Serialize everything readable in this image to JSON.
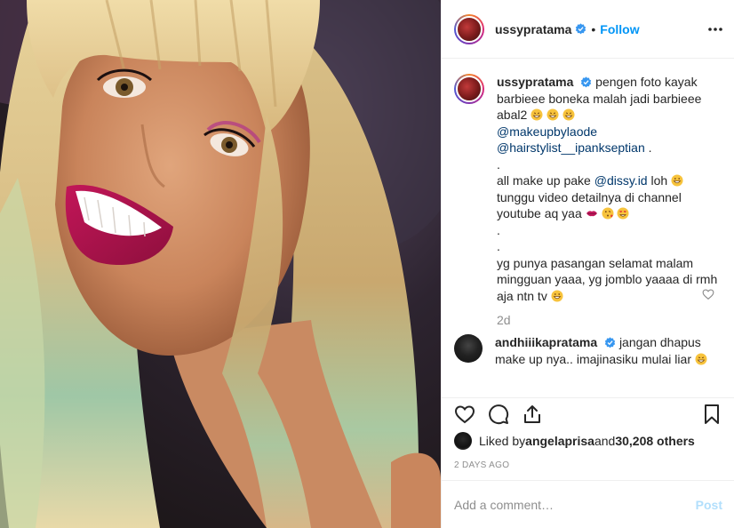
{
  "header": {
    "username": "ussypratama",
    "separator": "•",
    "follow_label": "Follow"
  },
  "caption": {
    "username": "ussypratama",
    "line1": "pengen foto kayak barbieee boneka malah jadi barbieee abal2",
    "mention1": "@makeupbylaode",
    "mention2": "@hairstylist__ipankseptian",
    "mention2_suffix": " .",
    "dot1": ".",
    "line_makeup_prefix": "all make up pake ",
    "mention3": "@dissy.id",
    "line_makeup_suffix": " loh",
    "line_video": "tunggu video detailnya di channel youtube aq yaa",
    "dot2": ".",
    "dot3": ".",
    "line_last": "yg punya pasangan selamat malam mingguan yaaa, yg jomblo yaaaa di rmh aja ntn tv",
    "time": "2d"
  },
  "comment": {
    "username": "andhiiikapratama",
    "text": "jangan dhapus make up nya.. imajinasiku mulai liar"
  },
  "likes": {
    "prefix": "Liked by ",
    "user": "angelaprisa",
    "middle": " and ",
    "count": "30,208 others"
  },
  "posted_ago": "2 DAYS AGO",
  "add_comment": {
    "placeholder": "Add a comment…",
    "post_label": "Post"
  },
  "colors": {
    "link": "#0095f6",
    "mention": "#00376b",
    "muted": "#8e8e8e",
    "border": "#efefef",
    "post_disabled": "#b2dffc"
  },
  "icons": [
    "verified-icon",
    "more-options-icon",
    "heart-icon",
    "comment-icon",
    "share-icon",
    "bookmark-icon",
    "small-heart-icon"
  ]
}
